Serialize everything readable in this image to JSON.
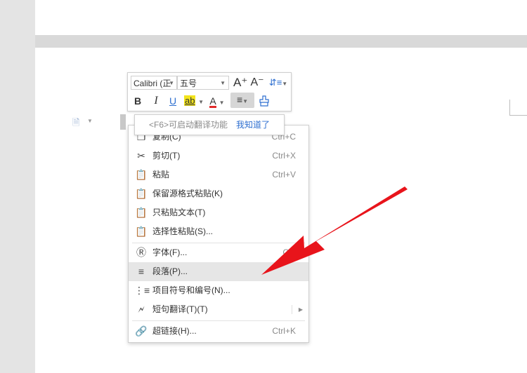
{
  "mini_toolbar": {
    "font_name": "Calibri (正",
    "font_size": "五号",
    "grow_font": "A⁺",
    "shrink_font": "A⁻",
    "bold": "B",
    "italic": "I",
    "underline": "U",
    "highlight": "ab",
    "font_color": "A"
  },
  "tooltip": {
    "hint": "<F6>可启动翻译功能",
    "dismiss": "我知道了"
  },
  "context_menu": {
    "items": [
      {
        "label": "复制(C)",
        "shortcut": "Ctrl+C",
        "icon": "copy-icon"
      },
      {
        "label": "剪切(T)",
        "shortcut": "Ctrl+X",
        "icon": "scissors-icon"
      },
      {
        "label": "粘贴",
        "shortcut": "Ctrl+V",
        "icon": "paste-icon"
      },
      {
        "label": "保留源格式粘贴(K)",
        "shortcut": "",
        "icon": "paste-keep-format-icon"
      },
      {
        "label": "只粘贴文本(T)",
        "shortcut": "",
        "icon": "paste-text-only-icon"
      },
      {
        "label": "选择性粘贴(S)...",
        "shortcut": "",
        "icon": "paste-special-icon"
      },
      {
        "label": "字体(F)...",
        "shortcut": "Ctrl",
        "icon": "font-icon"
      },
      {
        "label": "段落(P)...",
        "shortcut": "",
        "icon": "paragraph-icon",
        "highlighted": true
      },
      {
        "label": "项目符号和编号(N)...",
        "shortcut": "",
        "icon": "bullet-list-icon"
      },
      {
        "label": "短句翻译(T)(T)",
        "shortcut": "",
        "icon": "translate-icon",
        "has_submenu": true
      },
      {
        "label": "超链接(H)...",
        "shortcut": "Ctrl+K",
        "icon": "link-icon"
      }
    ]
  },
  "colors": {
    "accent": "#2e6fd0",
    "arrow": "#e8141b",
    "highlight_yellow": "#f3e41c",
    "font_color_red": "#e02a2a",
    "menu_hover": "#e6e6e6"
  }
}
